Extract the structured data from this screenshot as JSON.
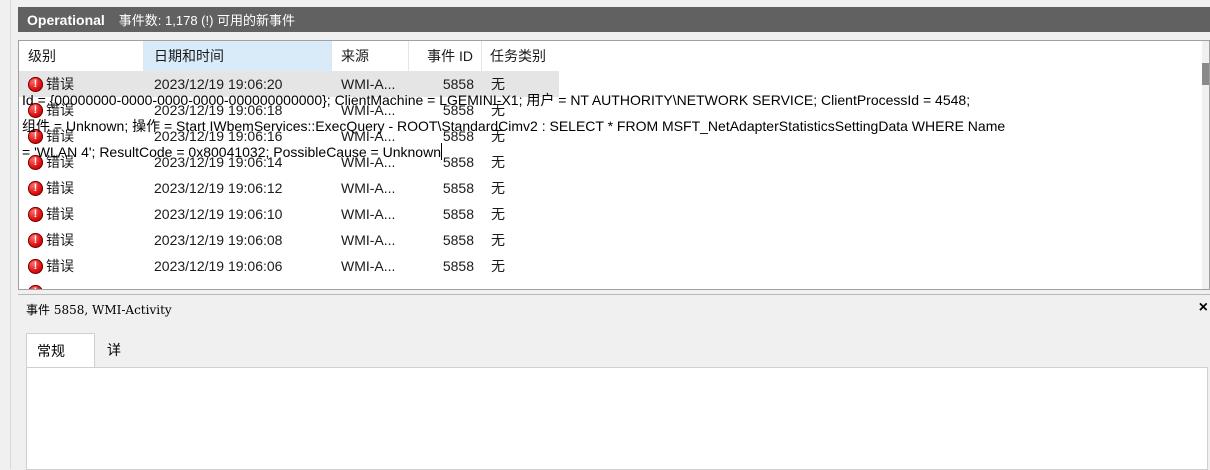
{
  "header": {
    "title": "Operational",
    "event_count": "事件数: 1,178 (!) 可用的新事件"
  },
  "columns": {
    "level": "级别",
    "date": "日期和时间",
    "source": "来源",
    "event_id": "事件 ID",
    "category": "任务类别"
  },
  "rows": [
    {
      "level": "错误",
      "date": "2023/12/19 19:06:20",
      "source": "WMI-A...",
      "event_id": "5858",
      "category": "无"
    },
    {
      "level": "错误",
      "date": "2023/12/19 19:06:18",
      "source": "WMI-A...",
      "event_id": "5858",
      "category": "无"
    },
    {
      "level": "错误",
      "date": "2023/12/19 19:06:16",
      "source": "WMI-A...",
      "event_id": "5858",
      "category": "无"
    },
    {
      "level": "错误",
      "date": "2023/12/19 19:06:14",
      "source": "WMI-A...",
      "event_id": "5858",
      "category": "无"
    },
    {
      "level": "错误",
      "date": "2023/12/19 19:06:12",
      "source": "WMI-A...",
      "event_id": "5858",
      "category": "无"
    },
    {
      "level": "错误",
      "date": "2023/12/19 19:06:10",
      "source": "WMI-A...",
      "event_id": "5858",
      "category": "无"
    },
    {
      "level": "错误",
      "date": "2023/12/19 19:06:08",
      "source": "WMI-A...",
      "event_id": "5858",
      "category": "无"
    },
    {
      "level": "错误",
      "date": "2023/12/19 19:06:06",
      "source": "WMI-A...",
      "event_id": "5858",
      "category": "无"
    }
  ],
  "detail": {
    "title": "事件 5858, WMI-Activity",
    "close": "×",
    "tabs": [
      "常规",
      "详细信息"
    ],
    "message_lines": [
      "Id = {00000000-0000-0000-0000-000000000000}; ClientMachine = LGEMINI-X1; 用户 = NT AUTHORITY\\NETWORK SERVICE; ClientProcessId = 4548;",
      "组件 = Unknown; 操作 = Start IWbemServices::ExecQuery - ROOT\\StandardCimv2 : SELECT * FROM MSFT_NetAdapterStatisticsSettingData WHERE Name",
      "= 'WLAN 4'; ResultCode = 0x80041032; PossibleCause = Unknown"
    ]
  },
  "colors": {
    "header_bg": "#616161",
    "selected_column_bg": "#d9ebf9",
    "error_red": "#d11111"
  },
  "icons": {
    "error": "error-icon"
  }
}
